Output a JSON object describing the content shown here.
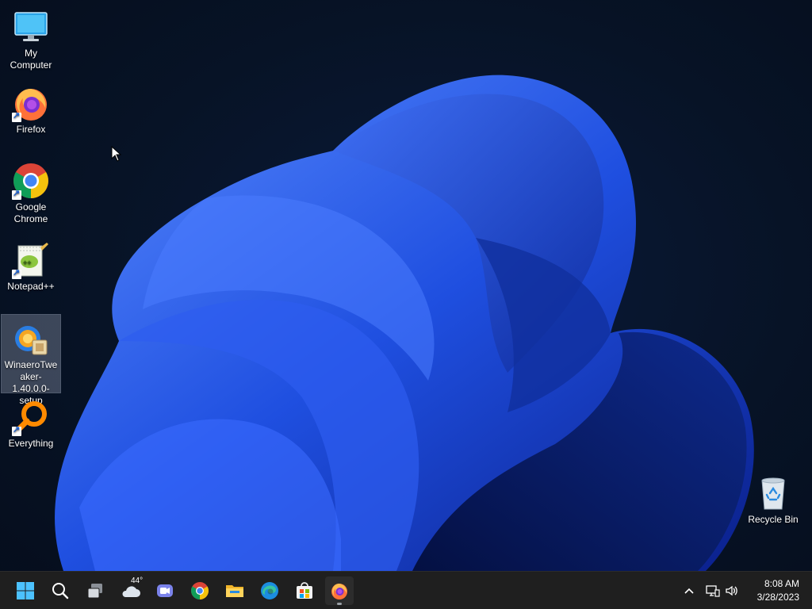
{
  "desktop": {
    "icons": [
      {
        "label": "My Computer",
        "icon": "monitor-icon"
      },
      {
        "label": "Firefox",
        "icon": "firefox-icon",
        "shortcut": true
      },
      {
        "label": "Google Chrome",
        "icon": "chrome-icon",
        "shortcut": true
      },
      {
        "label": "Notepad++",
        "icon": "notepadpp-icon",
        "shortcut": true
      },
      {
        "label": "WinaeroTweaker-1.40.0.0-setup",
        "icon": "installer-icon",
        "selected": true
      },
      {
        "label": "Everything",
        "icon": "everything-icon",
        "shortcut": true
      }
    ],
    "recycle_bin": {
      "label": "Recycle Bin",
      "icon": "recycle-bin-icon"
    }
  },
  "taskbar": {
    "items": [
      "start-icon",
      "search-icon",
      "task-view-icon",
      "weather-icon",
      "teams-chat-icon",
      "chrome-icon",
      "file-explorer-icon",
      "edge-icon",
      "store-icon",
      "firefox-icon"
    ],
    "weather_temp": "44°",
    "active_app": "firefox-icon"
  },
  "tray": {
    "time": "8:08 AM",
    "date": "3/28/2023"
  },
  "colors": {
    "taskbar": "#1f1f1f",
    "wallpaper_dark": "#071326",
    "bloom": "#1f4fe0"
  }
}
